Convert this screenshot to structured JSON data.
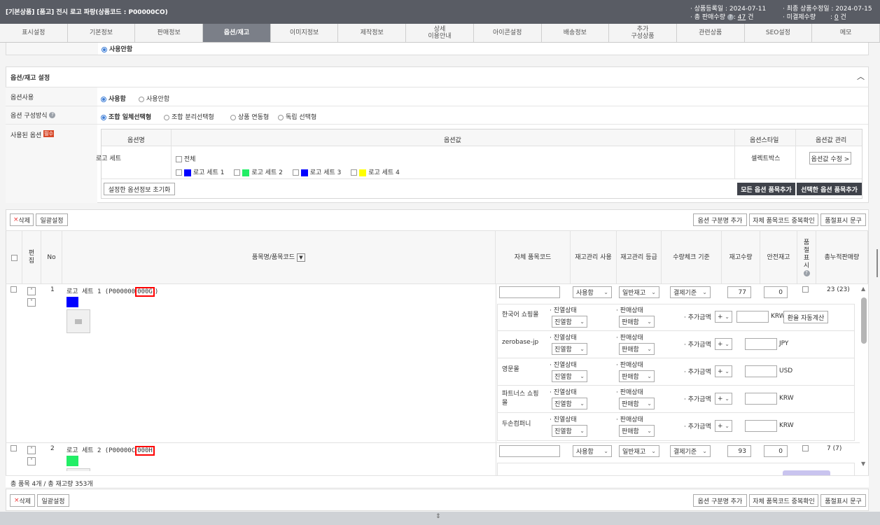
{
  "header": {
    "title": "[기본상품] [품고] 전시 로고 파랑(상품코드 : P00000CO)",
    "reg_date_label": "· 상품등록일",
    "reg_date": ": 2024-07-11",
    "total_sales_label": "· 총 판매수량",
    "total_sales_sep": ": ",
    "total_sales": "47",
    "total_sales_unit": " 건",
    "mod_date_label": "· 최종 상품수정일",
    "mod_date": ": 2024-07-15",
    "undecided_label": "· 미결제수량",
    "undecided_sep": ": ",
    "undecided": "0",
    "undecided_unit": " 건"
  },
  "tabs": [
    "표시설정",
    "기본정보",
    "판매정보",
    "옵션/재고",
    "이미지정보",
    "제작정보",
    "상세\n이용안내",
    "아이콘설정",
    "배송정보",
    "추가\n구성상품",
    "관련상품",
    "SEO설정",
    "메모"
  ],
  "prev_section": {
    "radio_label": "사용안함"
  },
  "option_section": {
    "title": "옵션/재고 설정",
    "use_label": "옵션사용",
    "use_on": "사용함",
    "use_off": "사용안함",
    "compose_label": "옵션 구성방식",
    "compose_options": [
      "조합 일체선택형",
      "조합 분리선택형",
      "상품 연동형",
      "독립 선택형"
    ],
    "used_options_label": "사용된 옵션",
    "badge": "필수",
    "table": {
      "headers": [
        "옵션명",
        "옵션값",
        "옵션스타일",
        "옵션값 관리"
      ],
      "name": "로고 세트",
      "all_label": "전체",
      "values": [
        {
          "label": "로고 세트 1",
          "color": "#0000ff"
        },
        {
          "label": "로고 세트 2",
          "color": "#22ee66"
        },
        {
          "label": "로고 세트 3",
          "color": "#0000ff"
        },
        {
          "label": "로고 세트 4",
          "color": "#ffff00"
        }
      ],
      "style": "셀렉트박스",
      "edit_button": "옵션값 수정 >"
    },
    "reset_button": "설정한 옵션정보 초기화",
    "add_all_button": "모든 옵션 품목추가",
    "add_selected_button": "선택한 옵션 품목추가"
  },
  "toolbar": {
    "delete_x": "×",
    "delete_label": "삭제",
    "batch": "일괄설정",
    "add_option_name": "옵션 구분명 추가",
    "check_code": "자체 품목코드 중복확인",
    "display_text": "품절표시 문구"
  },
  "grid_headers": {
    "edit": "편\n집",
    "no": "No",
    "name_code": "품목명/품목코드",
    "own_code": "자체 품목코드",
    "stock_use": "재고관리 사용",
    "stock_grade": "재고관리 등급",
    "qty_check": "수량체크 기준",
    "stock_qty": "재고수량",
    "safe_stock": "안전재고",
    "soldout": "품\n절\n표\n시",
    "cum_sales": "총누적판매량"
  },
  "items": [
    {
      "no": "1",
      "name_prefix": "로고 세트 1 (P000000",
      "code_hl": "000G",
      "name_suffix": ")",
      "color": "#0000ff",
      "stock_use": "사용함",
      "grade": "일반재고",
      "check": "결제기준",
      "qty": "77",
      "safe": "0",
      "sales": "23 (23)"
    },
    {
      "no": "2",
      "name_prefix": "로고 세트 2 (P00000C",
      "code_hl": "000H",
      "name_suffix": "",
      "color": "#22ee66",
      "stock_use": "사용함",
      "grade": "일반재고",
      "check": "결제기준",
      "qty": "93",
      "safe": "0",
      "sales": "7 (7)"
    }
  ],
  "malls": [
    {
      "name": "한국어 쇼핑몰",
      "currency": "KRW",
      "calc": "환율 자동계산"
    },
    {
      "name": "zerobase-jp",
      "currency": "JPY"
    },
    {
      "name": "영문몰",
      "currency": "USD"
    },
    {
      "name": "파트너스 쇼핑몰",
      "currency": "KRW"
    },
    {
      "name": "두손컴퍼니",
      "currency": "KRW"
    }
  ],
  "mall_fields": {
    "display_label": "· 진열상태",
    "display_value": "진열함",
    "sale_label": "· 판매상태",
    "sale_value": "판매함",
    "extra_label": "· 추가금액",
    "sign": "+"
  },
  "footer": {
    "summary": "총 품목 4개 / 총 재고량 353개"
  }
}
